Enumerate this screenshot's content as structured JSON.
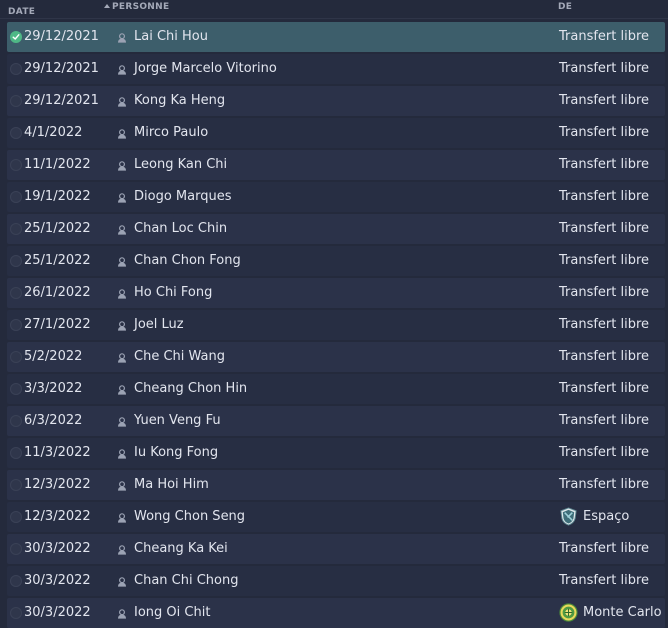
{
  "header": {
    "date": "DATE",
    "person": "PERSONNE",
    "from": "DE"
  },
  "icons": {
    "person": "person-silhouette-icon",
    "check": "check-circle-icon",
    "club_espaco": "shield-badge-icon",
    "club_monte_carlo": "club-round-badge-icon"
  },
  "colors": {
    "background": "#242a3c",
    "row_selected": "#3d5e6b",
    "check_active": "#4fb886",
    "text": "#e2e5ee"
  },
  "rows": [
    {
      "date": "29/12/2021",
      "name": "Lai Chi Hou",
      "from": "Transfert libre",
      "selected": true
    },
    {
      "date": "29/12/2021",
      "name": "Jorge Marcelo Vitorino",
      "from": "Transfert libre"
    },
    {
      "date": "29/12/2021",
      "name": "Kong Ka Heng",
      "from": "Transfert libre"
    },
    {
      "date": "4/1/2022",
      "name": "Mirco Paulo",
      "from": "Transfert libre"
    },
    {
      "date": "11/1/2022",
      "name": "Leong Kan Chi",
      "from": "Transfert libre"
    },
    {
      "date": "19/1/2022",
      "name": "Diogo Marques",
      "from": "Transfert libre"
    },
    {
      "date": "25/1/2022",
      "name": "Chan Loc Chin",
      "from": "Transfert libre"
    },
    {
      "date": "25/1/2022",
      "name": "Chan Chon Fong",
      "from": "Transfert libre"
    },
    {
      "date": "26/1/2022",
      "name": "Ho Chi Fong",
      "from": "Transfert libre"
    },
    {
      "date": "27/1/2022",
      "name": "Joel Luz",
      "from": "Transfert libre"
    },
    {
      "date": "5/2/2022",
      "name": "Che Chi Wang",
      "from": "Transfert libre"
    },
    {
      "date": "3/3/2022",
      "name": "Cheang Chon Hin",
      "from": "Transfert libre"
    },
    {
      "date": "6/3/2022",
      "name": "Yuen Veng Fu",
      "from": "Transfert libre"
    },
    {
      "date": "11/3/2022",
      "name": "Iu Kong Fong",
      "from": "Transfert libre"
    },
    {
      "date": "12/3/2022",
      "name": "Ma Hoi Him",
      "from": "Transfert libre"
    },
    {
      "date": "12/3/2022",
      "name": "Wong Chon Seng",
      "from": "Espaço",
      "club_icon": "shield-badge-icon"
    },
    {
      "date": "30/3/2022",
      "name": "Cheang Ka Kei",
      "from": "Transfert libre"
    },
    {
      "date": "30/3/2022",
      "name": "Chan Chi Chong",
      "from": "Transfert libre"
    },
    {
      "date": "30/3/2022",
      "name": "Iong Oi Chit",
      "from": "Monte Carlo",
      "club_icon": "club-round-badge-icon"
    }
  ]
}
